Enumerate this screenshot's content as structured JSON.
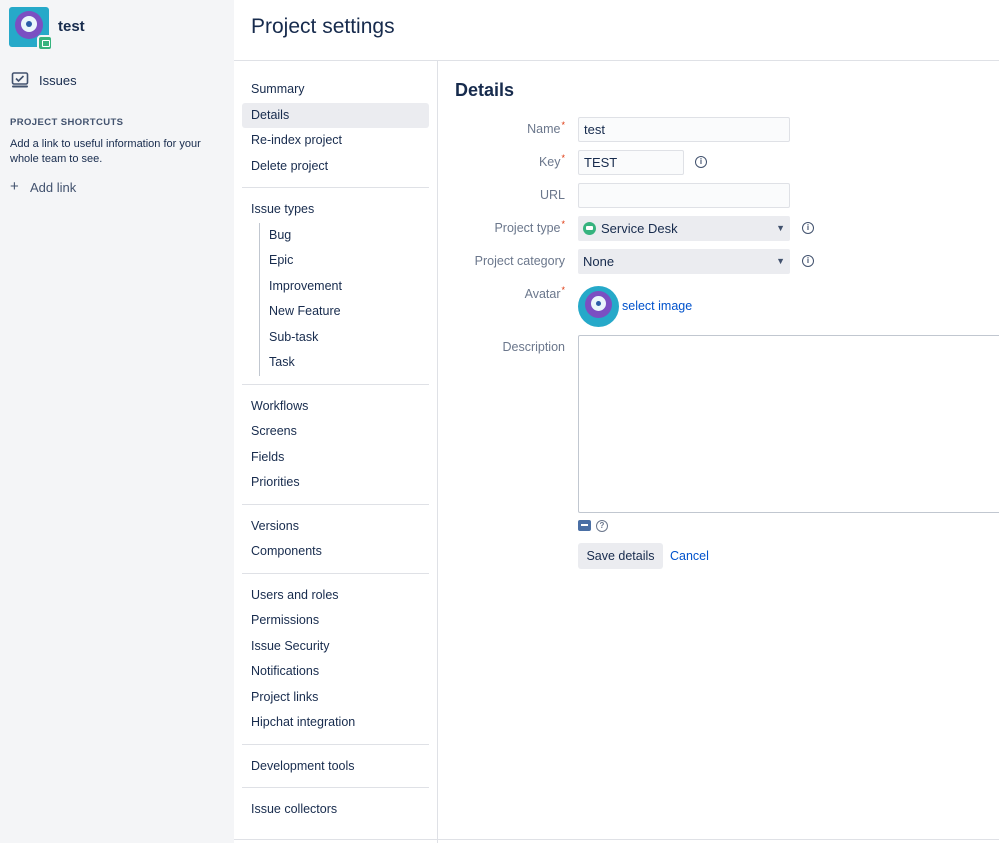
{
  "project": {
    "name": "test",
    "issues_label": "Issues"
  },
  "shortcuts": {
    "title": "PROJECT SHORTCUTS",
    "description": "Add a link to useful information for your whole team to see.",
    "add_link_label": "Add link"
  },
  "page": {
    "title": "Project settings"
  },
  "settings_nav": {
    "group1": [
      "Summary",
      "Details",
      "Re-index project",
      "Delete project"
    ],
    "issue_types_label": "Issue types",
    "issue_types": [
      "Bug",
      "Epic",
      "Improvement",
      "New Feature",
      "Sub-task",
      "Task"
    ],
    "group3": [
      "Workflows",
      "Screens",
      "Fields",
      "Priorities"
    ],
    "group4": [
      "Versions",
      "Components"
    ],
    "group5": [
      "Users and roles",
      "Permissions",
      "Issue Security",
      "Notifications",
      "Project links",
      "Hipchat integration"
    ],
    "group6": [
      "Development tools"
    ],
    "group7": [
      "Issue collectors"
    ],
    "active": "Details"
  },
  "details": {
    "title": "Details",
    "name_label": "Name",
    "name_value": "test",
    "key_label": "Key",
    "key_value": "TEST",
    "url_label": "URL",
    "url_value": "",
    "project_type_label": "Project type",
    "project_type_value": "Service Desk",
    "project_category_label": "Project category",
    "project_category_value": "None",
    "avatar_label": "Avatar",
    "select_image_label": "select image",
    "description_label": "Description",
    "description_value": "",
    "save_label": "Save details",
    "cancel_label": "Cancel"
  },
  "colors": {
    "sidebar_bg": "#f4f5f7",
    "link": "#0052cc",
    "required": "#de350b",
    "service_desk": "#36b37e"
  }
}
